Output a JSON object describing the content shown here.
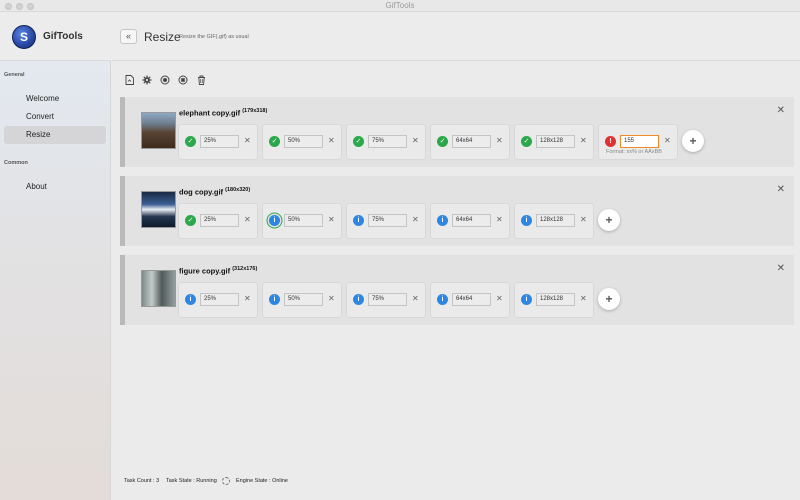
{
  "window": {
    "title": "GifTools"
  },
  "sidebar": {
    "brand": "GifTools",
    "logo_glyph": "S",
    "sections": [
      {
        "title": "General",
        "items": [
          {
            "label": "Welcome"
          },
          {
            "label": "Convert"
          },
          {
            "label": "Resize",
            "active": true
          }
        ]
      },
      {
        "title": "Common",
        "items": [
          {
            "label": "About"
          }
        ]
      }
    ]
  },
  "header": {
    "back_glyph": "«",
    "title": "Resize",
    "subtitle": "Resize the GIF(.gif) as usual"
  },
  "toolbar": {
    "icons": [
      "add-file-icon",
      "settings-icon",
      "record-icon",
      "stop-icon",
      "trash-icon"
    ]
  },
  "files": [
    {
      "name": "elephant copy.gif",
      "dims": "(179x318)",
      "sizes": [
        {
          "value": "25%",
          "status": "ok"
        },
        {
          "value": "50%",
          "status": "ok"
        },
        {
          "value": "75%",
          "status": "ok"
        },
        {
          "value": "64x64",
          "status": "ok"
        },
        {
          "value": "128x128",
          "status": "ok"
        },
        {
          "value": "155",
          "status": "error",
          "hint": "Format: xx% or AAxBB"
        }
      ]
    },
    {
      "name": "dog copy.gif",
      "dims": "(180x320)",
      "sizes": [
        {
          "value": "25%",
          "status": "ok"
        },
        {
          "value": "50%",
          "status": "info-active"
        },
        {
          "value": "75%",
          "status": "info"
        },
        {
          "value": "64x64",
          "status": "info"
        },
        {
          "value": "128x128",
          "status": "info"
        }
      ]
    },
    {
      "name": "figure copy.gif",
      "dims": "(312x176)",
      "sizes": [
        {
          "value": "25%",
          "status": "info"
        },
        {
          "value": "50%",
          "status": "info"
        },
        {
          "value": "75%",
          "status": "info"
        },
        {
          "value": "64x64",
          "status": "info"
        },
        {
          "value": "128x128",
          "status": "info"
        }
      ]
    }
  ],
  "statusbar": {
    "task_count": "Task Count : 3",
    "task_state": "Task State : Running",
    "engine_state": "Engine State : Online"
  },
  "colors": {
    "ok": "#2aa84a",
    "info": "#2d87e2",
    "error": "#e03131",
    "error_border": "#f08a2c"
  }
}
